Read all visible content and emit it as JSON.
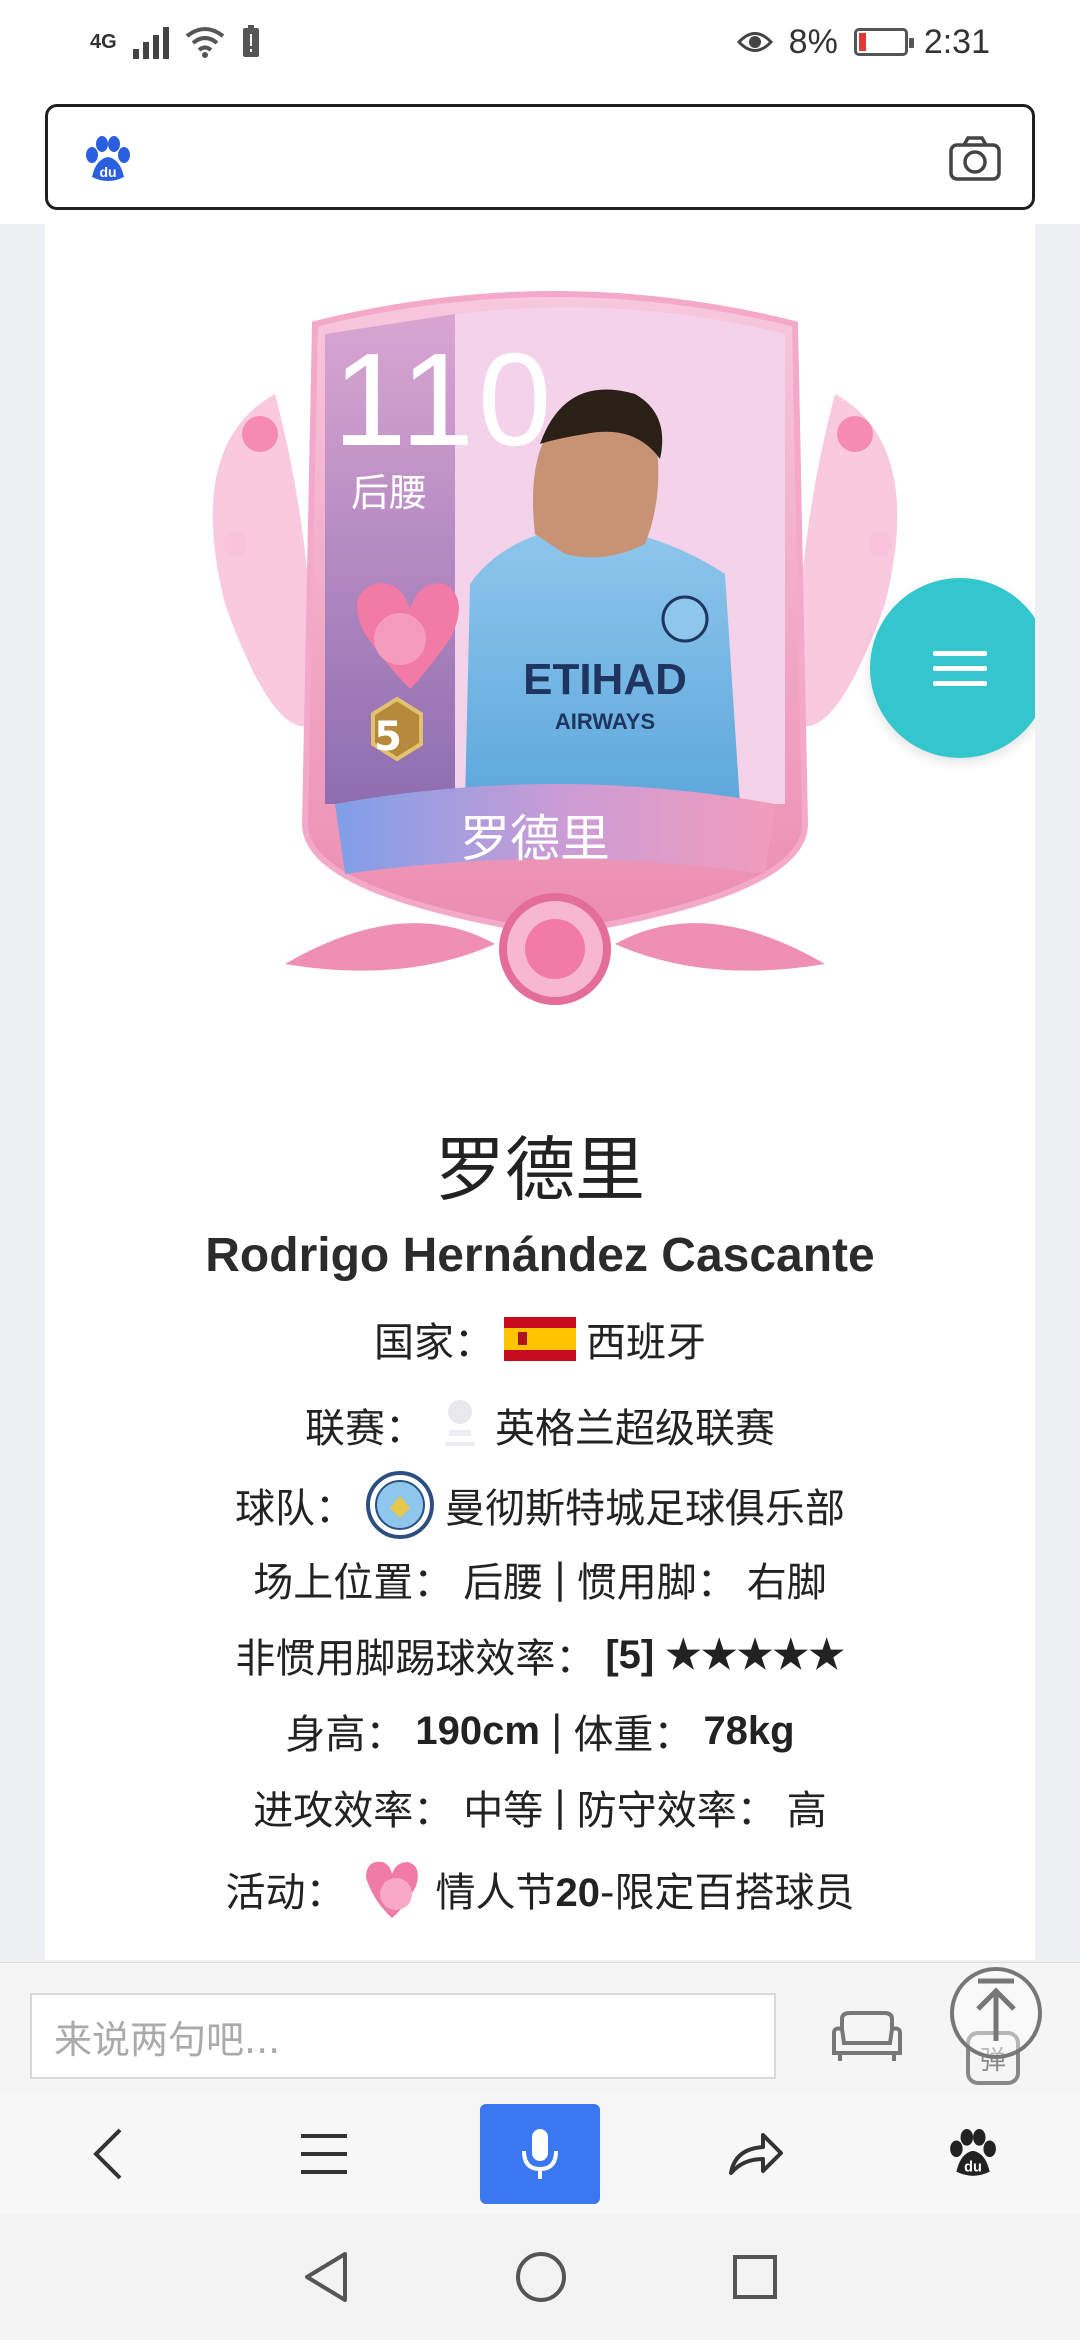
{
  "status_bar": {
    "network": "4G",
    "battery_text": "8%",
    "battery_level": 0.08,
    "time": "2:31"
  },
  "search": {
    "placeholder": ""
  },
  "card": {
    "rating": "110",
    "position": "后腰",
    "level": "5",
    "name": "罗德里"
  },
  "player": {
    "name_cn": "罗德里",
    "name_en": "Rodrigo Hernández Cascante",
    "country_label": "国家：",
    "country": "西班牙",
    "league_label": "联赛：",
    "league": "英格兰超级联赛",
    "team_label": "球队：",
    "team": "曼彻斯特城足球俱乐部",
    "position_label": "场上位置：",
    "position": "后腰",
    "sep1": " | ",
    "foot_label": "惯用脚：",
    "foot": "右脚",
    "weak_foot_label": "非惯用脚踢球效率：",
    "weak_foot": "[5] ★★★★★",
    "height_label": "身高：",
    "height": "190cm",
    "weight_label": "体重：",
    "weight": "78kg",
    "attack_label": "进攻效率：",
    "attack": "中等",
    "defense_label": "防守效率：",
    "defense": "高",
    "event_label": "活动：",
    "event_prefix": "情人节",
    "event_bold": "20",
    "event_suffix": "-限定百搭球员"
  },
  "comment": {
    "placeholder": "来说两句吧..."
  },
  "colors": {
    "fab": "#33c6cc",
    "mic": "#3a78f2"
  },
  "icons": [
    "baidu-paw-icon",
    "camera-icon",
    "menu-icon",
    "sofa-icon",
    "danmu-icon",
    "scroll-top-icon",
    "back-icon",
    "menu-lines-icon",
    "mic-icon",
    "share-icon",
    "baidu-home-icon",
    "nav-back-icon",
    "nav-home-icon",
    "nav-recents-icon"
  ]
}
